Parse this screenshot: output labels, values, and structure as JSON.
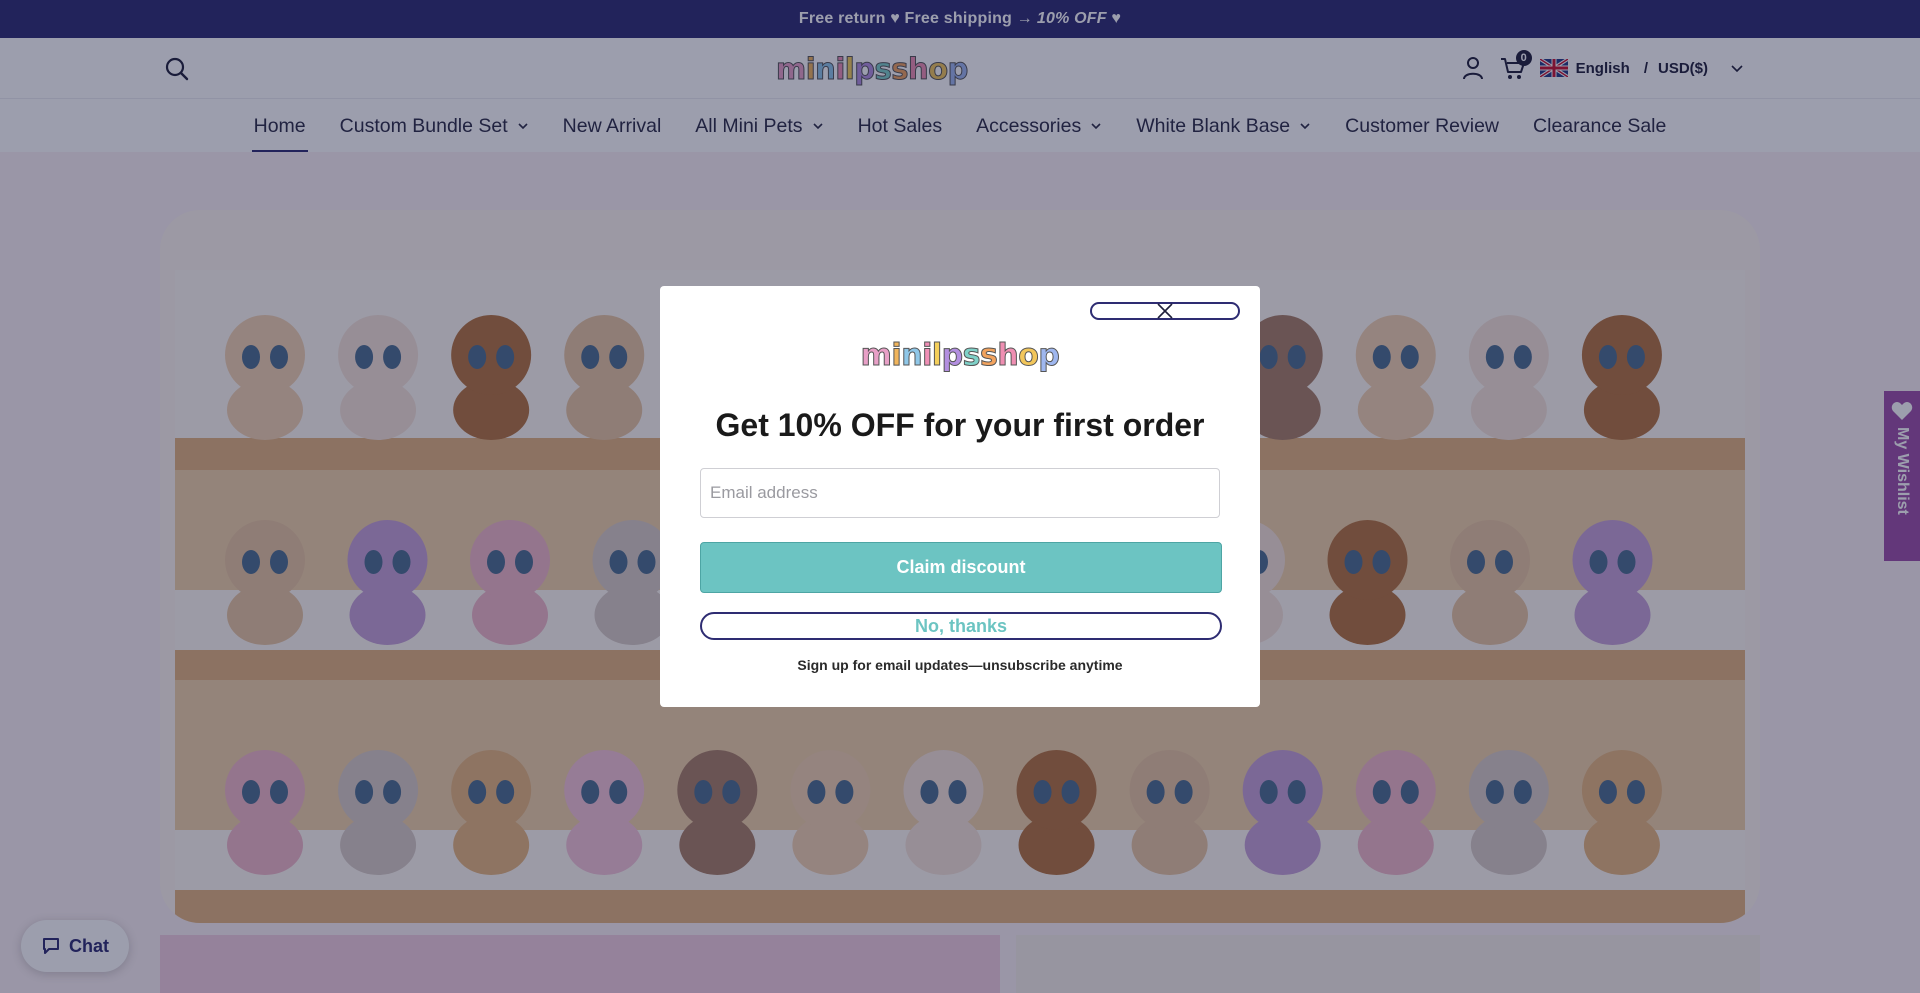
{
  "announcement": {
    "text": "Free return ♥ Free shipping →",
    "emphasis": "10% OFF ♥"
  },
  "header": {
    "logo_letters": [
      "m",
      "i",
      "n",
      "i",
      "l",
      "p",
      "s",
      "s",
      "h",
      "o",
      "p"
    ],
    "logo_colors": [
      "#e8a0c7",
      "#f1b55c",
      "#8fc7e8",
      "#f08fb6",
      "#f4cf5a",
      "#b38fe0",
      "#7fd1c8",
      "#f2a35e",
      "#ef8fb2",
      "#f2c65b",
      "#9fb7ef"
    ],
    "cart_count": "0",
    "language": "English",
    "currency": "USD($)",
    "icons": [
      "search-icon",
      "account-icon",
      "cart-icon",
      "uk-flag-icon",
      "chevron-down-icon"
    ]
  },
  "nav": {
    "items": [
      {
        "label": "Home",
        "dropdown": false,
        "active": true
      },
      {
        "label": "Custom Bundle Set",
        "dropdown": true
      },
      {
        "label": "New Arrival",
        "dropdown": false
      },
      {
        "label": "All Mini Pets",
        "dropdown": true
      },
      {
        "label": "Hot Sales",
        "dropdown": false
      },
      {
        "label": "Accessories",
        "dropdown": true
      },
      {
        "label": "White Blank Base",
        "dropdown": true
      },
      {
        "label": "Customer Review",
        "dropdown": false
      },
      {
        "label": "Clearance Sale",
        "dropdown": false
      }
    ]
  },
  "wishlist": {
    "label": "My Wishlist"
  },
  "chat": {
    "label": "Chat"
  },
  "popup": {
    "title": "Get 10% OFF for your first order",
    "email_placeholder": "Email address",
    "claim_label": "Claim discount",
    "decline_label": "No, thanks",
    "fine_print": "Sign up for email updates—unsubscribe anytime"
  },
  "colors": {
    "brand_navy": "#2e2c72",
    "teal": "#6cc4c2",
    "wishlist_purple": "#9d4fa7"
  }
}
